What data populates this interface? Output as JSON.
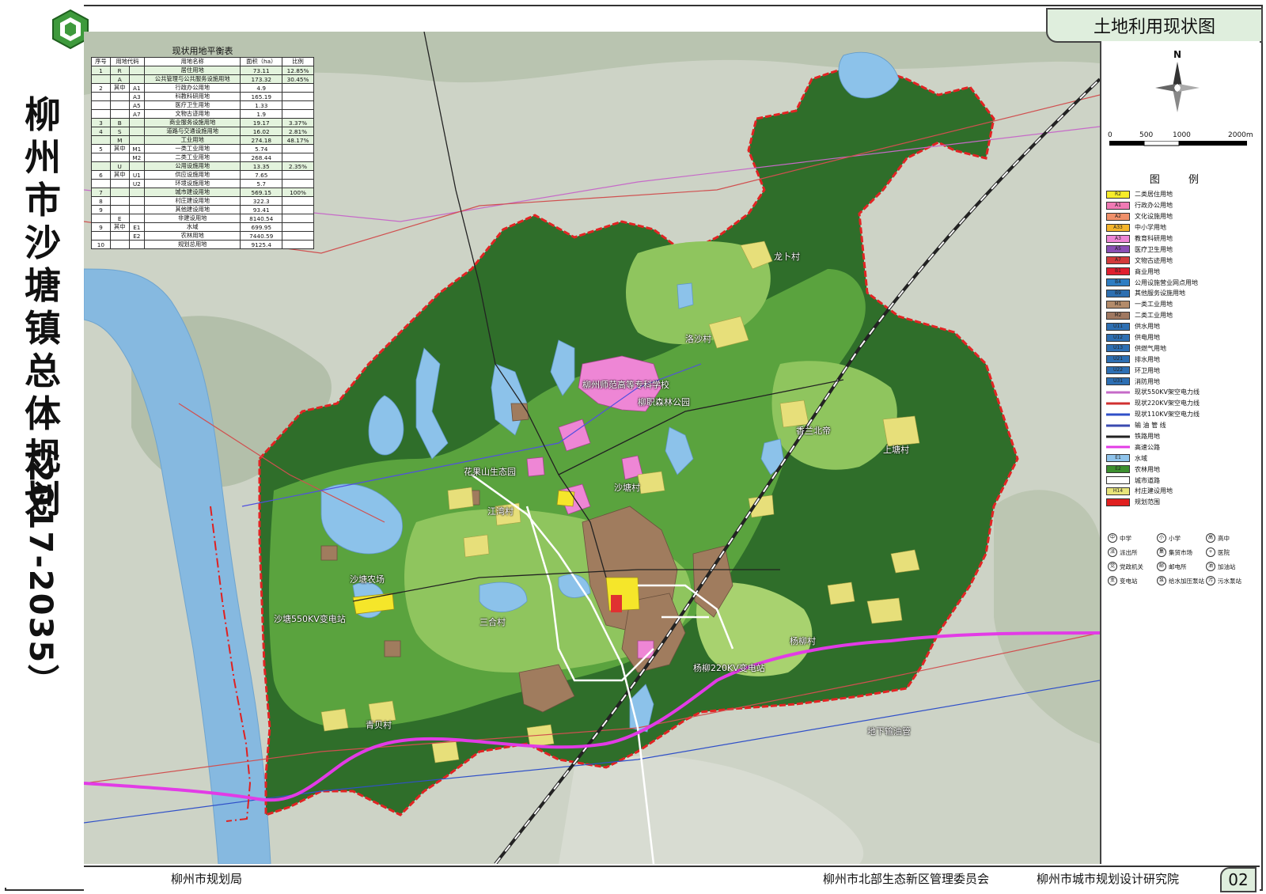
{
  "header": {
    "title": "土地利用现状图",
    "page_number": "02"
  },
  "plan_title": {
    "name": "柳州市沙塘镇总体规划",
    "years": "（2017-2035）"
  },
  "balance_table": {
    "title": "现状用地平衡表",
    "headers": [
      "序号",
      "用地代码",
      "",
      "用地名称",
      "面积（ha）",
      "比例"
    ],
    "rows": [
      {
        "no": "1",
        "code": "R",
        "sub": "",
        "name": "居住用地",
        "area": "73.11",
        "ratio": "12.85%",
        "g": true
      },
      {
        "no": "",
        "code": "A",
        "sub": "",
        "name": "公共管理与公共服务设施用地",
        "area": "173.32",
        "ratio": "30.45%",
        "g": true
      },
      {
        "no": "2",
        "code": "其中",
        "sub": "A1",
        "name": "行政办公用地",
        "area": "4.9",
        "ratio": "",
        "g": false
      },
      {
        "no": "",
        "code": "",
        "sub": "A3",
        "name": "科教科研用地",
        "area": "165.19",
        "ratio": "",
        "g": false
      },
      {
        "no": "",
        "code": "",
        "sub": "A5",
        "name": "医疗卫生用地",
        "area": "1.33",
        "ratio": "",
        "g": false
      },
      {
        "no": "",
        "code": "",
        "sub": "A7",
        "name": "文物古迹用地",
        "area": "1.9",
        "ratio": "",
        "g": false
      },
      {
        "no": "3",
        "code": "B",
        "sub": "",
        "name": "商业服务设施用地",
        "area": "19.17",
        "ratio": "3.37%",
        "g": true
      },
      {
        "no": "4",
        "code": "S",
        "sub": "",
        "name": "道路与交通设施用地",
        "area": "16.02",
        "ratio": "2.81%",
        "g": true
      },
      {
        "no": "",
        "code": "M",
        "sub": "",
        "name": "工业用地",
        "area": "274.18",
        "ratio": "48.17%",
        "g": true
      },
      {
        "no": "5",
        "code": "其中",
        "sub": "M1",
        "name": "一类工业用地",
        "area": "5.74",
        "ratio": "",
        "g": false
      },
      {
        "no": "",
        "code": "",
        "sub": "M2",
        "name": "二类工业用地",
        "area": "268.44",
        "ratio": "",
        "g": false
      },
      {
        "no": "",
        "code": "U",
        "sub": "",
        "name": "公用设施用地",
        "area": "13.35",
        "ratio": "2.35%",
        "g": true
      },
      {
        "no": "6",
        "code": "其中",
        "sub": "U1",
        "name": "供应设施用地",
        "area": "7.65",
        "ratio": "",
        "g": false
      },
      {
        "no": "",
        "code": "",
        "sub": "U2",
        "name": "环境设施用地",
        "area": "5.7",
        "ratio": "",
        "g": false
      },
      {
        "no": "7",
        "code": "",
        "sub": "",
        "name": "城市建设用地",
        "area": "569.15",
        "ratio": "100%",
        "g": true
      },
      {
        "no": "8",
        "code": "",
        "sub": "",
        "name": "村庄建设用地",
        "area": "322.3",
        "ratio": "",
        "g": false
      },
      {
        "no": "9",
        "code": "",
        "sub": "",
        "name": "其他建设用地",
        "area": "93.41",
        "ratio": "",
        "g": false
      },
      {
        "no": "",
        "code": "E",
        "sub": "",
        "name": "非建设用地",
        "area": "8140.54",
        "ratio": "",
        "g": false
      },
      {
        "no": "9",
        "code": "其中",
        "sub": "E1",
        "name": "水域",
        "area": "699.95",
        "ratio": "",
        "g": false
      },
      {
        "no": "",
        "code": "",
        "sub": "E2",
        "name": "农林用地",
        "area": "7440.59",
        "ratio": "",
        "g": false
      },
      {
        "no": "10",
        "code": "",
        "sub": "",
        "name": "规划总用地",
        "area": "9125.4",
        "ratio": "",
        "g": false
      }
    ]
  },
  "north_arrow": {
    "label": "N"
  },
  "scale": {
    "ticks": [
      "0",
      "500",
      "1000",
      "2000m"
    ]
  },
  "legend": {
    "title": "图 例",
    "items": [
      {
        "code": "R2",
        "label": "二类居住用地",
        "color": "#f7ec2a"
      },
      {
        "code": "A1",
        "label": "行政办公用地",
        "color": "#f07ab4"
      },
      {
        "code": "A2",
        "label": "文化设施用地",
        "color": "#f0906a"
      },
      {
        "code": "A33",
        "label": "中小学用地",
        "color": "#f5b52a"
      },
      {
        "code": "A3",
        "label": "教育科研用地",
        "color": "#ee86d5"
      },
      {
        "code": "A5",
        "label": "医疗卫生用地",
        "color": "#8a4fb5"
      },
      {
        "code": "A7",
        "label": "文物古迹用地",
        "color": "#d23b3b"
      },
      {
        "code": "B1",
        "label": "商业用地",
        "color": "#e01f2f"
      },
      {
        "code": "B4",
        "label": "公用设施营业网点用地",
        "color": "#2e7dc2"
      },
      {
        "code": "B9",
        "label": "其他服务设施用地",
        "color": "#2e6fb0"
      },
      {
        "code": "M1",
        "label": "一类工业用地",
        "color": "#b38b6a"
      },
      {
        "code": "M2",
        "label": "二类工业用地",
        "color": "#a07860"
      },
      {
        "code": "U11",
        "label": "供水用地",
        "color": "#2d6fb3"
      },
      {
        "code": "U12",
        "label": "供电用地",
        "color": "#2d6fb3"
      },
      {
        "code": "U13",
        "label": "供燃气用地",
        "color": "#2d6fb3"
      },
      {
        "code": "U21",
        "label": "排水用地",
        "color": "#2d6fb3"
      },
      {
        "code": "U22",
        "label": "环卫用地",
        "color": "#2d6fb3"
      },
      {
        "code": "U31",
        "label": "消防用地",
        "color": "#2d6fb3"
      }
    ],
    "lines": [
      {
        "label": "现状550KV架空电力线",
        "color": "#c66ac8"
      },
      {
        "label": "现状220KV架空电力线",
        "color": "#d03030"
      },
      {
        "label": "现状110KV架空电力线",
        "color": "#3050c8"
      },
      {
        "label": "输 油 管 线",
        "color": "#3a4ab0"
      },
      {
        "label": "铁路用地",
        "color": "#222222"
      },
      {
        "label": "高速公路",
        "color": "#e23be6"
      }
    ],
    "areas": [
      {
        "code": "E1",
        "label": "水域",
        "color": "#8fc4ec"
      },
      {
        "code": "E2",
        "label": "农林用地",
        "color": "#3c8f2f"
      },
      {
        "code": "",
        "label": "城市道路",
        "color": "#ffffff"
      },
      {
        "code": "H14",
        "label": "村庄建设用地",
        "color": "#e8e47a"
      },
      {
        "code": "",
        "label": "规划范围",
        "color": "#e02020"
      }
    ]
  },
  "poi_legend": [
    {
      "sym": "中",
      "label": "中学"
    },
    {
      "sym": "小",
      "label": "小学"
    },
    {
      "sym": "高",
      "label": "高中"
    },
    {
      "sym": "派",
      "label": "派出所"
    },
    {
      "sym": "集",
      "label": "集贸市场"
    },
    {
      "sym": "+",
      "label": "医院"
    },
    {
      "sym": "党",
      "label": "党政机关"
    },
    {
      "sym": "邮",
      "label": "邮电所"
    },
    {
      "sym": "油",
      "label": "加油站"
    },
    {
      "sym": "变",
      "label": "变电站"
    },
    {
      "sym": "泵",
      "label": "给水加压泵站"
    },
    {
      "sym": "污",
      "label": "污水泵站"
    }
  ],
  "map_labels": [
    "龙卜村",
    "洛沙村",
    "柳州师范高等专科学校",
    "柳职森林公园",
    "花果山生态园",
    "沙塘村",
    "江湾村",
    "香兰北帝",
    "上塘村",
    "三合村",
    "杨柳村",
    "沙塘农场",
    "沙塘550KV变电站",
    "青贝村",
    "杨柳220KV变电站",
    "地下输油管"
  ],
  "footer": {
    "orgs": [
      "柳州市规划局",
      "柳州市北部生态新区管理委员会",
      "柳州市城市规划设计研究院"
    ]
  }
}
